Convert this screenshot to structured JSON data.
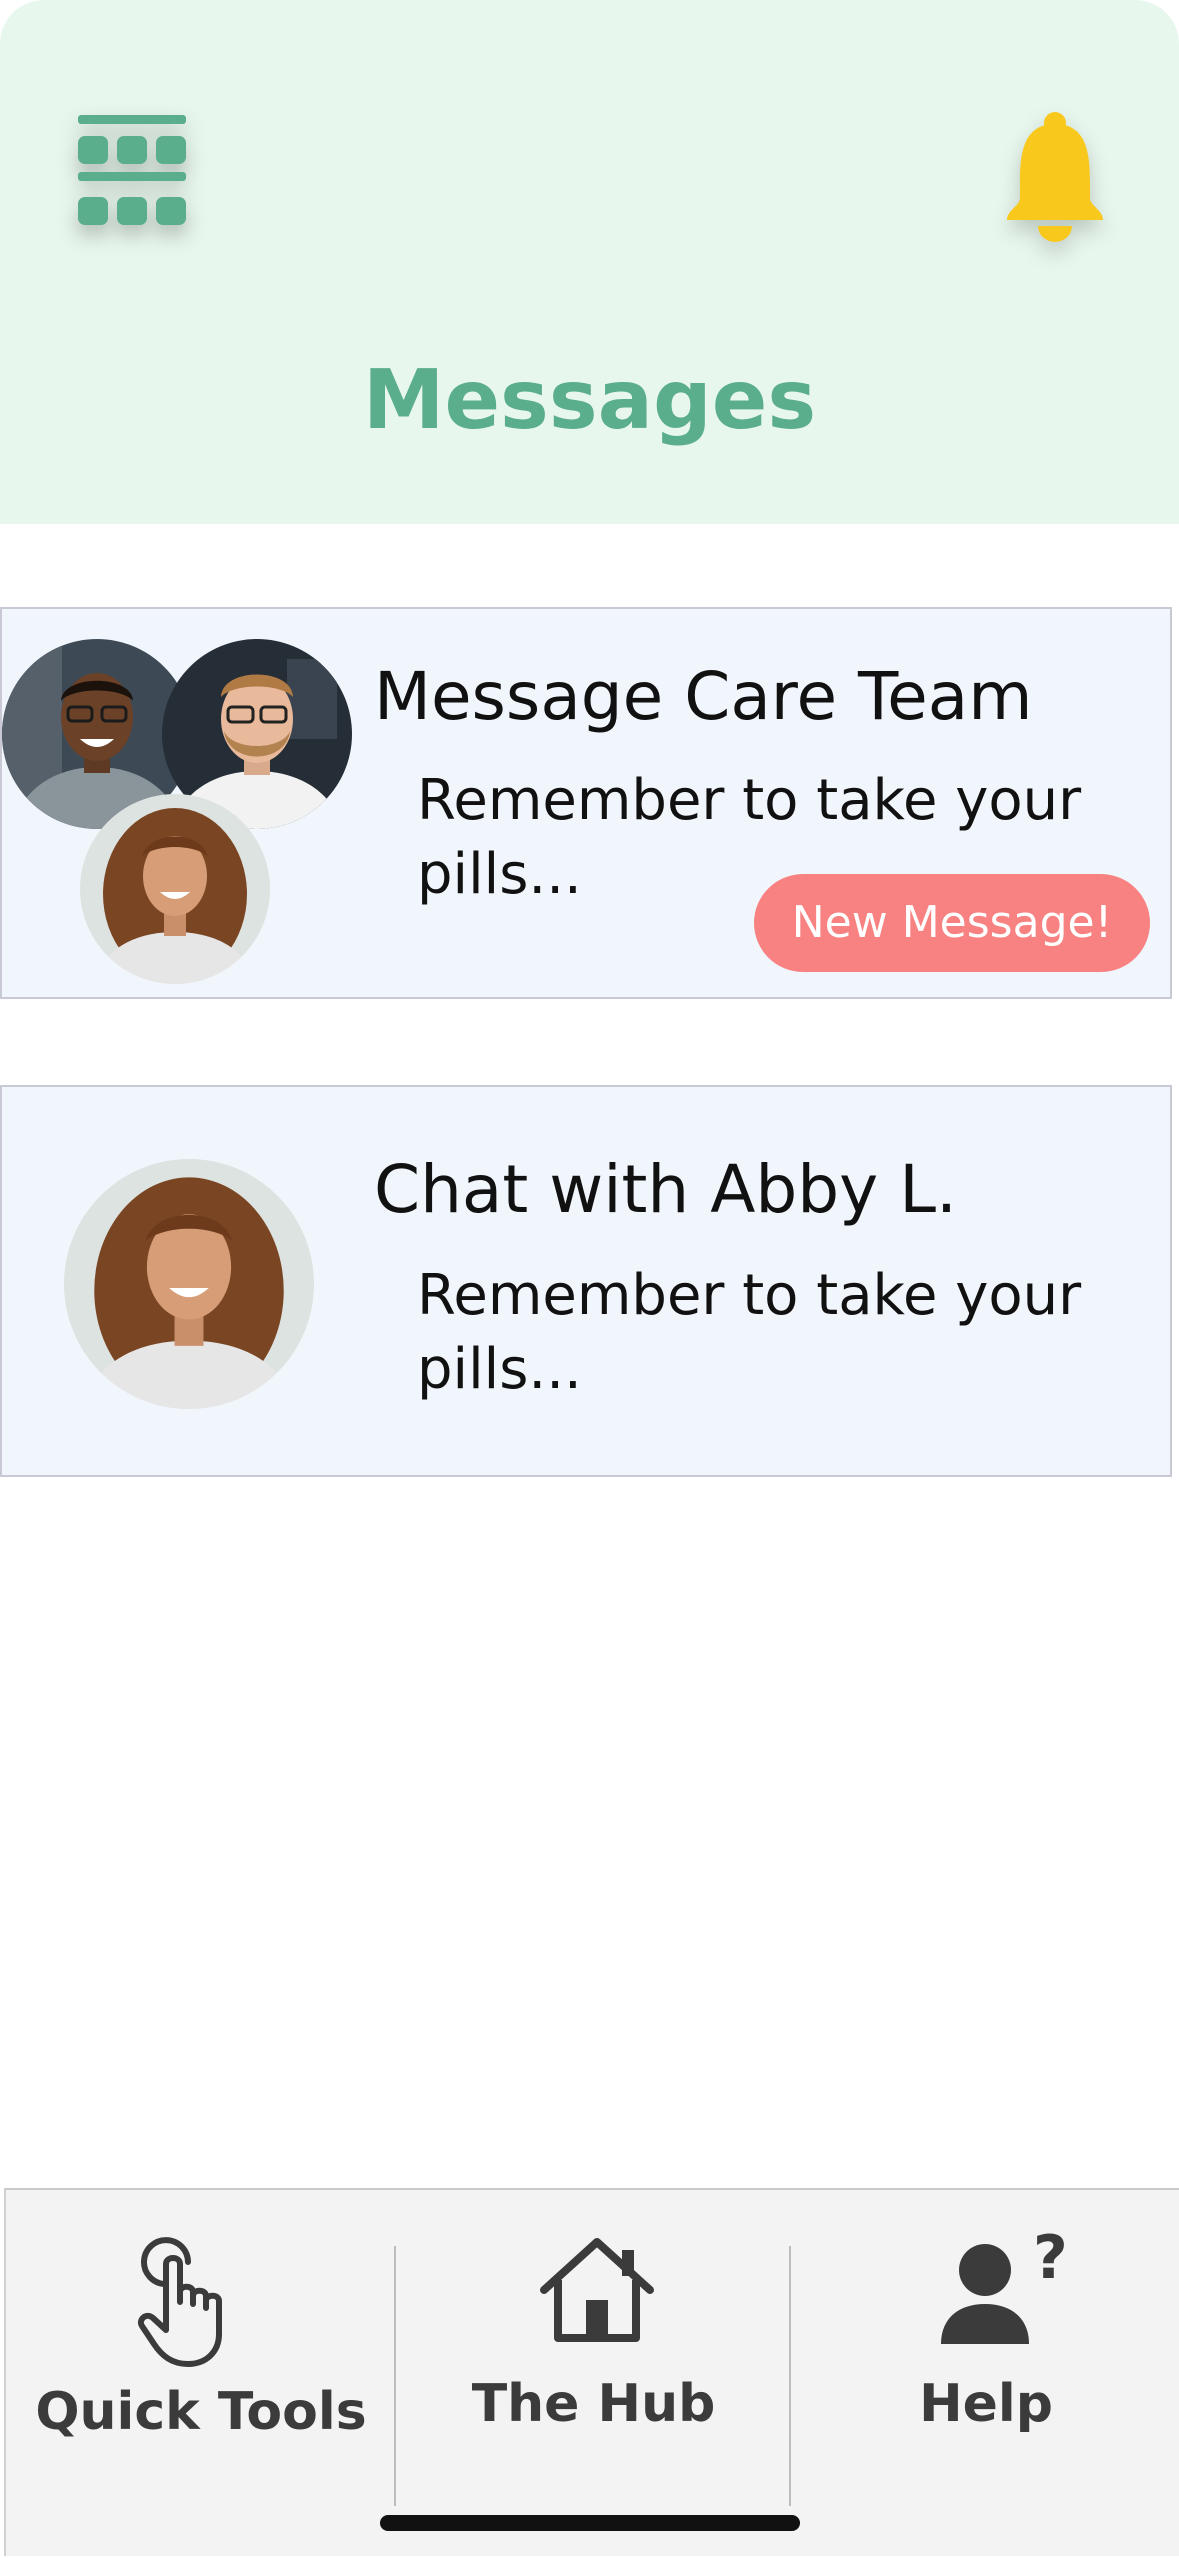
{
  "header": {
    "title": "Messages",
    "menu_icon": "grid-menu-icon",
    "notification_icon": "bell-icon",
    "colors": {
      "background": "#e8f7ee",
      "title": "#5aae8c",
      "bell": "#f9c81d"
    }
  },
  "conversations": [
    {
      "title": "Message Care Team",
      "preview": "Remember to take your pills...",
      "badge": "New Message!",
      "avatars": [
        "avatar-man-smiling",
        "avatar-man-glasses",
        "avatar-woman-curly-hair"
      ]
    },
    {
      "title": "Chat with Abby L.",
      "preview": "Remember to take your pills...",
      "avatars": [
        "avatar-woman-curly-hair"
      ]
    }
  ],
  "bottom_nav": {
    "items": [
      {
        "label": "Quick Tools",
        "icon": "pointing-hand-icon"
      },
      {
        "label": "The Hub",
        "icon": "home-icon"
      },
      {
        "label": "Help",
        "icon": "person-question-icon"
      }
    ]
  },
  "colors": {
    "card_background": "#f1f6fd",
    "badge": "#f88282",
    "nav_background": "#f3f3f3"
  }
}
